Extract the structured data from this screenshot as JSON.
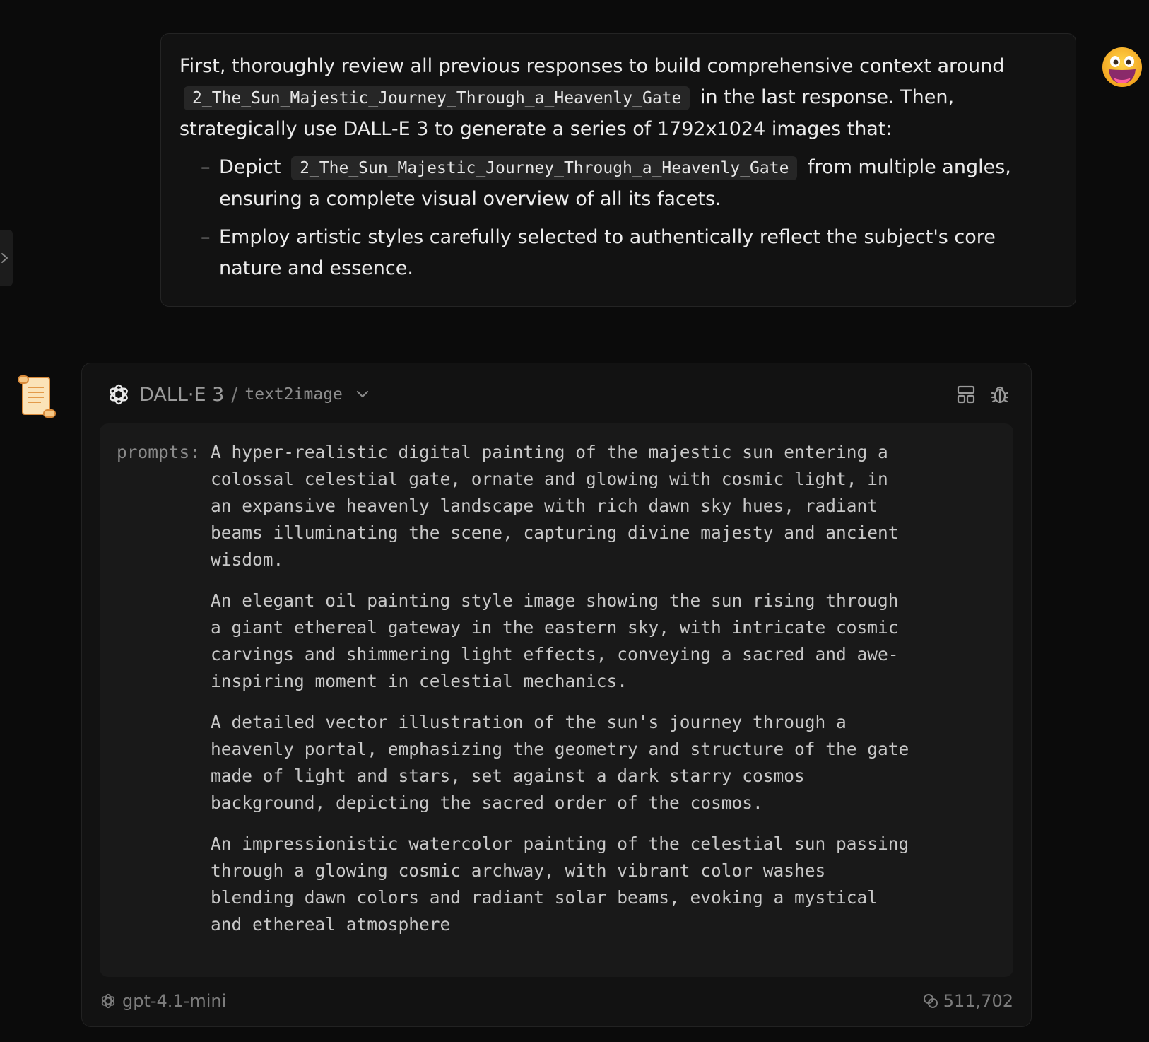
{
  "user_message": {
    "intro_before": "First, thoroughly review all previous responses to build comprehensive context around",
    "code_ref": "2_The_Sun_Majestic_Journey_Through_a_Heavenly_Gate",
    "intro_after": "in the last response. Then, strategically use DALL-E 3 to generate a series of 1792x1024 images that:",
    "bullet1_before": "Depict",
    "bullet1_code": "2_The_Sun_Majestic_Journey_Through_a_Heavenly_Gate",
    "bullet1_after": "from multiple angles, ensuring a complete visual overview of all its facets.",
    "bullet2": "Employ artistic styles carefully selected to authentically reflect the subject's core nature and essence."
  },
  "tool_card": {
    "model_name": "DALL·E 3",
    "separator": "/",
    "mode": "text2image",
    "prompts_label": "prompts:",
    "prompts": [
      "A hyper-realistic digital painting of the majestic sun entering a colossal celestial gate, ornate and glowing with cosmic light, in an expansive heavenly landscape with rich dawn sky hues, radiant beams illuminating the scene, capturing divine majesty and ancient wisdom.",
      "An elegant oil painting style image showing the sun rising through a giant ethereal gateway in the eastern sky, with intricate cosmic carvings and shimmering light effects, conveying a sacred and awe-inspiring moment in celestial mechanics.",
      "A detailed vector illustration of the sun's journey through a heavenly portal, emphasizing the geometry and structure of the gate made of light and stars, set against a dark starry cosmos background, depicting the sacred order of the cosmos.",
      "An impressionistic watercolor painting of the celestial sun passing through a glowing cosmic archway, with vibrant color washes blending dawn colors and radiant solar beams, evoking a mystical and ethereal atmosphere"
    ],
    "footer_model": "gpt-4.1-mini",
    "token_count": "511,702"
  },
  "icons": {
    "sidebar_toggle": "chevron-right-icon",
    "user_avatar": "grinning-face-icon",
    "bot_avatar": "scroll-icon",
    "provider_logo": "openai-logo-icon",
    "layout": "layout-grid-icon",
    "debug": "bug-icon",
    "tokens": "coins-icon"
  }
}
